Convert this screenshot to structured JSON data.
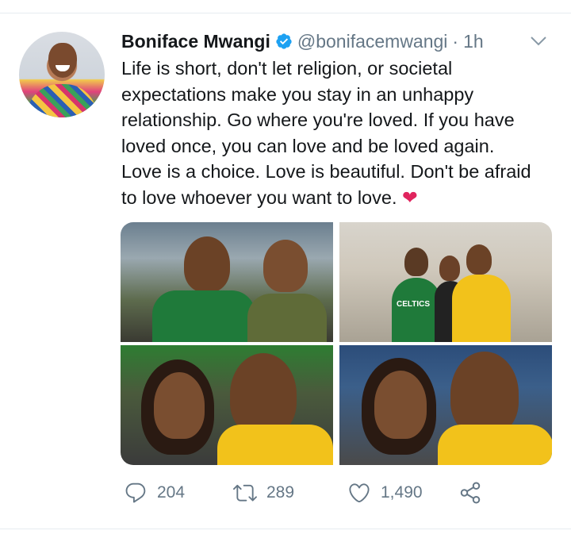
{
  "tweet": {
    "display_name": "Boniface Mwangi",
    "handle": "@bonifacemwangi",
    "separator": "·",
    "time": "1h",
    "text_lines": [
      "Life is short, don't let religion, or societal",
      "expectations make you stay in an unhappy",
      "relationship. Go where you're loved. If you have",
      "loved once, you can love and be loved again.",
      "Love is a choice. Love is beautiful. Don't be afraid",
      "to love whoever you want to love."
    ],
    "emoji": "❤",
    "media": [
      {
        "name": "photo-1"
      },
      {
        "name": "photo-2"
      },
      {
        "name": "photo-3"
      },
      {
        "name": "photo-4"
      }
    ],
    "jersey_text": "CELTICS"
  },
  "actions": {
    "reply_count": "204",
    "retweet_count": "289",
    "like_count": "1,490"
  },
  "colors": {
    "text": "#14171a",
    "secondary": "#657786",
    "verified": "#1da1f2",
    "heart": "#e0245e",
    "divider": "#e6ecf0"
  },
  "icons": [
    "verified-badge-icon",
    "chevron-down-icon",
    "reply-icon",
    "retweet-icon",
    "like-icon",
    "share-icon"
  ]
}
